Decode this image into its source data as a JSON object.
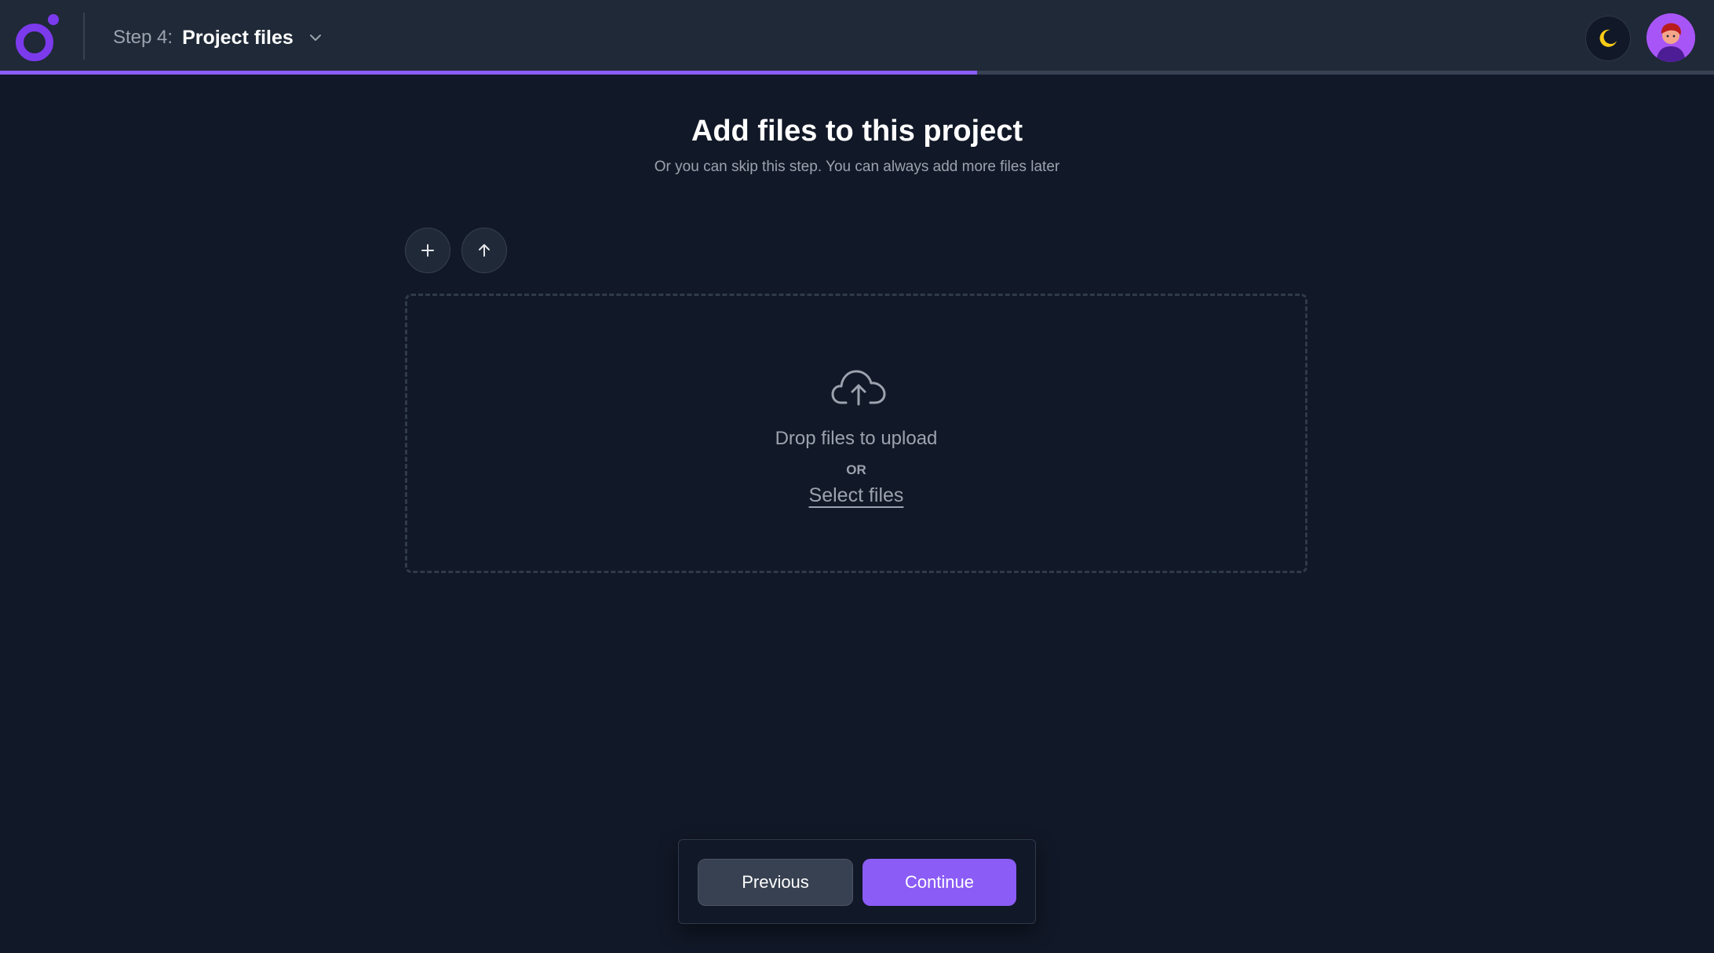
{
  "header": {
    "step_prefix": "Step 4:",
    "step_name": "Project files",
    "progress_fraction": 0.57,
    "icons": {
      "logo": "brand-logo",
      "step_menu": "chevron-down-icon",
      "theme_toggle": "moon-icon",
      "avatar": "user-avatar"
    }
  },
  "main": {
    "title": "Add files to this project",
    "subtitle": "Or you can skip this step. You can always add more files later",
    "toolbar": {
      "add_icon": "plus-icon",
      "upload_icon": "arrow-up-icon"
    },
    "dropzone": {
      "icon": "cloud-upload-icon",
      "drop_text": "Drop files to upload",
      "or_text": "OR",
      "select_text": "Select files"
    }
  },
  "footer": {
    "previous_label": "Previous",
    "continue_label": "Continue"
  },
  "colors": {
    "background": "#111827",
    "header_bg": "#1f2937",
    "accent": "#8b5cf6",
    "moon": "#facc15"
  }
}
